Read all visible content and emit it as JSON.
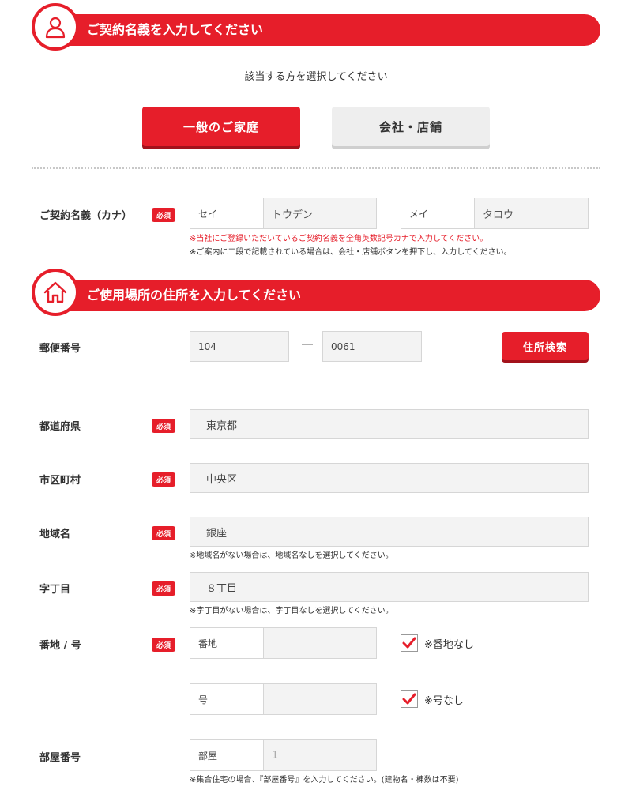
{
  "contract_section": {
    "title": "ご契約名義を入力してください",
    "icon": "user-icon"
  },
  "intro": "該当する方を選択してください",
  "type_buttons": {
    "household": "一般のご家庭",
    "company": "会社・店舗"
  },
  "contract_name": {
    "label": "ご契約名義（カナ）",
    "required": "必須",
    "sei_label": "セイ",
    "sei_value": "トウデン",
    "mei_label": "メイ",
    "mei_value": "タロウ",
    "note_red": "※当社にご登録いただいているご契約名義を全角英数記号カナで入力してください。",
    "note": "※ご案内に二段で記載されている場合は、会社・店舗ボタンを押下し、入力してください。"
  },
  "address_section": {
    "title": "ご使用場所の住所を入力してください",
    "icon": "house-icon"
  },
  "postal": {
    "label": "郵便番号",
    "first": "104",
    "separator": "―",
    "second": "0061",
    "search_button": "住所検索"
  },
  "prefecture": {
    "label": "都道府県",
    "required": "必須",
    "value": "東京都"
  },
  "city": {
    "label": "市区町村",
    "required": "必須",
    "value": "中央区"
  },
  "area": {
    "label": "地域名",
    "required": "必須",
    "value": "銀座",
    "note": "※地域名がない場合は、地域名なしを選択してください。"
  },
  "chome": {
    "label": "字丁目",
    "required": "必須",
    "value": "８丁目",
    "note": "※字丁目がない場合は、字丁目なしを選択してください。"
  },
  "banchi": {
    "label": "番地 / 号",
    "required": "必須",
    "banchi_label": "番地",
    "banchi_value": "",
    "no_banchi": "※番地なし",
    "go_label": "号",
    "go_value": "",
    "no_go": "※号なし"
  },
  "room": {
    "label": "部屋番号",
    "room_label": "部屋",
    "placeholder": "1",
    "note": "※集合住宅の場合、『部屋番号』を入力してください。(建物名・棟数は不要)"
  },
  "colors": {
    "accent": "#e61e2a"
  }
}
